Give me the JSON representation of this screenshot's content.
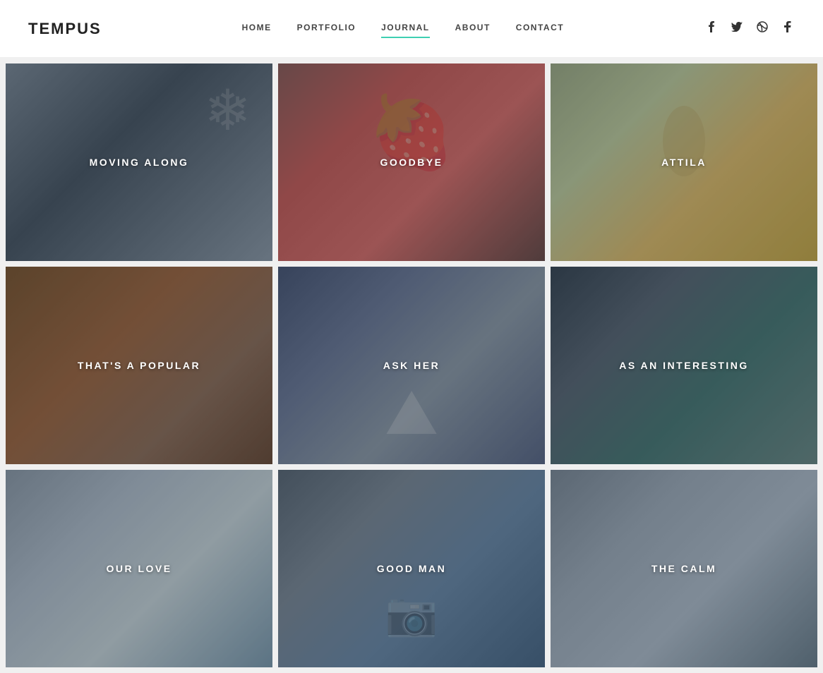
{
  "header": {
    "logo": "TEMPUS",
    "nav": [
      {
        "label": "HOME",
        "active": false,
        "id": "home"
      },
      {
        "label": "PORTFOLIO",
        "active": false,
        "id": "portfolio"
      },
      {
        "label": "JOURNAL",
        "active": true,
        "id": "journal"
      },
      {
        "label": "ABOUT",
        "active": false,
        "id": "about"
      },
      {
        "label": "CONTACT",
        "active": false,
        "id": "contact"
      }
    ],
    "social": [
      {
        "icon": "f",
        "name": "facebook"
      },
      {
        "icon": "t",
        "name": "twitter"
      },
      {
        "icon": "◎",
        "name": "dribbble"
      },
      {
        "icon": "t",
        "name": "tumblr"
      }
    ]
  },
  "grid": {
    "items": [
      {
        "id": 1,
        "title": "MOVING ALONG",
        "card": "card-1"
      },
      {
        "id": 2,
        "title": "GOODBYE",
        "card": "card-2"
      },
      {
        "id": 3,
        "title": "ATTILA",
        "card": "card-3"
      },
      {
        "id": 4,
        "title": "THAT'S A POPULAR",
        "card": "card-4"
      },
      {
        "id": 5,
        "title": "ASK HER",
        "card": "card-5"
      },
      {
        "id": 6,
        "title": "AS AN INTERESTING",
        "card": "card-6"
      },
      {
        "id": 7,
        "title": "OUR LOVE",
        "card": "card-7"
      },
      {
        "id": 8,
        "title": "GOOD MAN",
        "card": "card-8"
      },
      {
        "id": 9,
        "title": "THE CALM",
        "card": "card-9"
      }
    ]
  }
}
